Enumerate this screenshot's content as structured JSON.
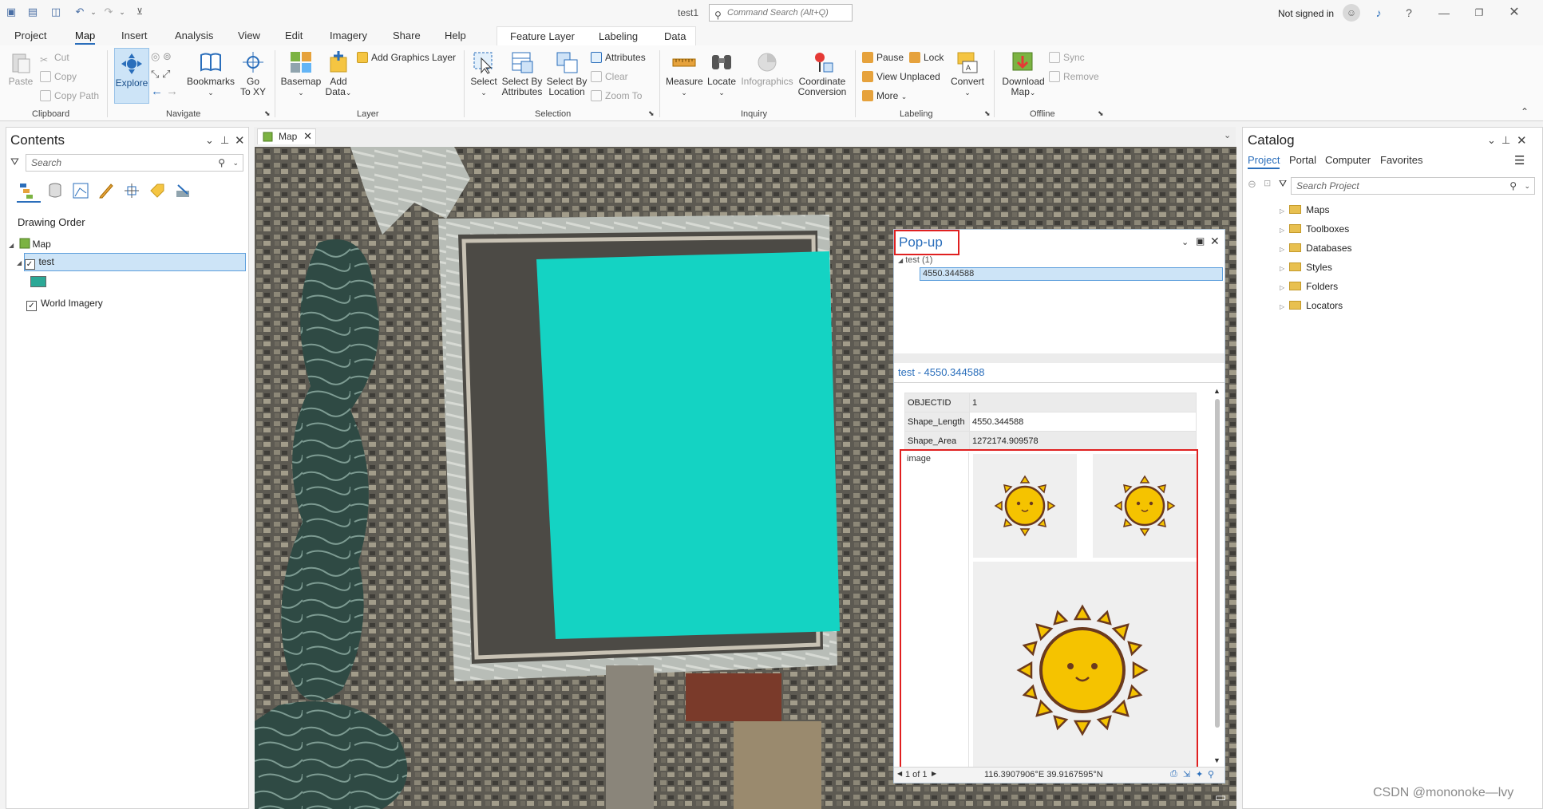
{
  "titlebar": {
    "doc_title": "test1",
    "command_search_placeholder": "Command Search (Alt+Q)",
    "signin": "Not signed in"
  },
  "menu_tabs": [
    "Project",
    "Map",
    "Insert",
    "Analysis",
    "View",
    "Edit",
    "Imagery",
    "Share",
    "Help"
  ],
  "context_tabs": [
    "Feature Layer",
    "Labeling",
    "Data"
  ],
  "active_tab": "Map",
  "ribbon": {
    "clipboard": {
      "paste": "Paste",
      "cut": "Cut",
      "copy": "Copy",
      "copy_path": "Copy Path",
      "group": "Clipboard"
    },
    "navigate": {
      "explore": "Explore",
      "bookmarks": "Bookmarks",
      "goto1": "Go",
      "goto2": "To XY",
      "group": "Navigate"
    },
    "layer": {
      "basemap": "Basemap",
      "add_data1": "Add",
      "add_data2": "Data",
      "add_graphics": "Add Graphics Layer",
      "group": "Layer"
    },
    "selection": {
      "select": "Select",
      "sba1": "Select By",
      "sba2": "Attributes",
      "sbl1": "Select By",
      "sbl2": "Location",
      "attributes": "Attributes",
      "clear": "Clear",
      "zoom_to": "Zoom To",
      "group": "Selection"
    },
    "inquiry": {
      "measure": "Measure",
      "locate": "Locate",
      "infographics": "Infographics",
      "coord1": "Coordinate",
      "coord2": "Conversion",
      "group": "Inquiry"
    },
    "labeling": {
      "pause": "Pause",
      "lock": "Lock",
      "view_unplaced": "View Unplaced",
      "more": "More",
      "convert": "Convert",
      "group": "Labeling"
    },
    "offline": {
      "download1": "Download",
      "download2": "Map",
      "sync": "Sync",
      "remove": "Remove",
      "group": "Offline"
    }
  },
  "contents": {
    "title": "Contents",
    "search_placeholder": "Search",
    "drawing_order": "Drawing Order",
    "map_label": "Map",
    "layer_test": "test",
    "layer_world": "World Imagery",
    "symbol_color": "#2ba896"
  },
  "map_tab": "Map",
  "popup": {
    "title": "Pop-up",
    "tree_layer": "test (1)",
    "tree_feature": "4550.344588",
    "feature_title": "test - 4550.344588",
    "fields": [
      {
        "name": "OBJECTID",
        "value": "1"
      },
      {
        "name": "Shape_Length",
        "value": "4550.344588"
      },
      {
        "name": "Shape_Area",
        "value": "1272174.909578"
      }
    ],
    "image_field": "image",
    "pager": "1 of 1",
    "coords": "116.3907906°E 39.9167595°N"
  },
  "catalog": {
    "title": "Catalog",
    "tabs": [
      "Project",
      "Portal",
      "Computer",
      "Favorites"
    ],
    "search_placeholder": "Search Project",
    "items": [
      "Maps",
      "Toolboxes",
      "Databases",
      "Styles",
      "Folders",
      "Locators"
    ]
  },
  "watermark": "CSDN @mononoke—lvy",
  "colors": {
    "polygon": "#14d3c3",
    "accent": "#2a6ebb",
    "highlight": "#e02020"
  }
}
